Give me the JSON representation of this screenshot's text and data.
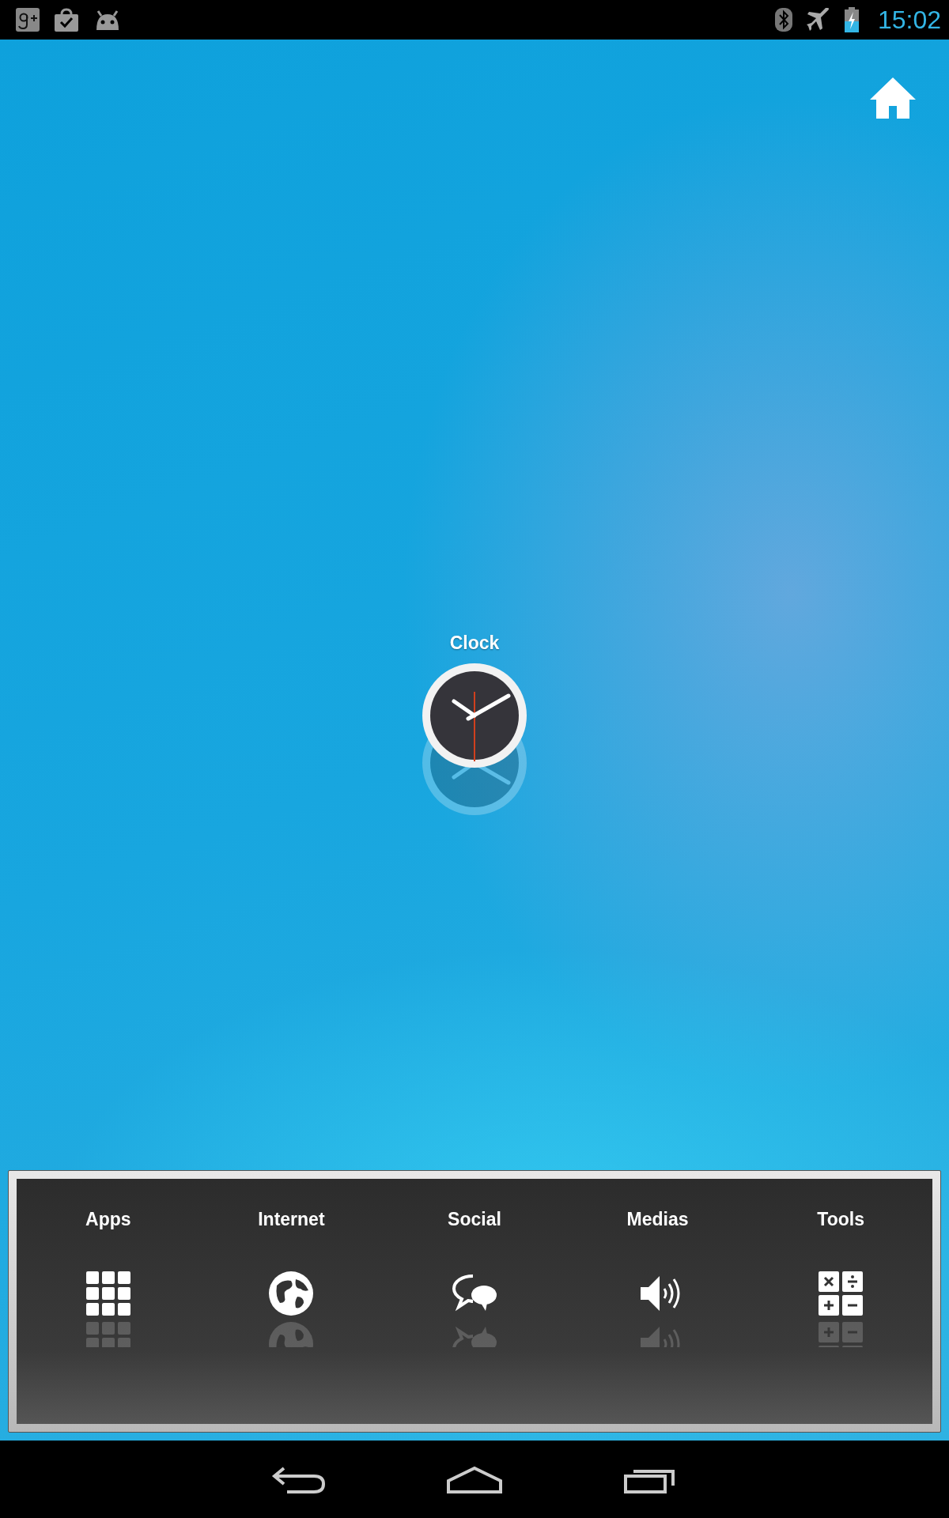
{
  "status_bar": {
    "time": "15:02"
  },
  "shortcut": {
    "label": "Clock"
  },
  "dock": {
    "items": [
      {
        "label": "Apps",
        "kind": "grid"
      },
      {
        "label": "Internet",
        "kind": "globe"
      },
      {
        "label": "Social",
        "kind": "chat"
      },
      {
        "label": "Medias",
        "kind": "speaker"
      },
      {
        "label": "Tools",
        "kind": "calculator"
      }
    ]
  }
}
